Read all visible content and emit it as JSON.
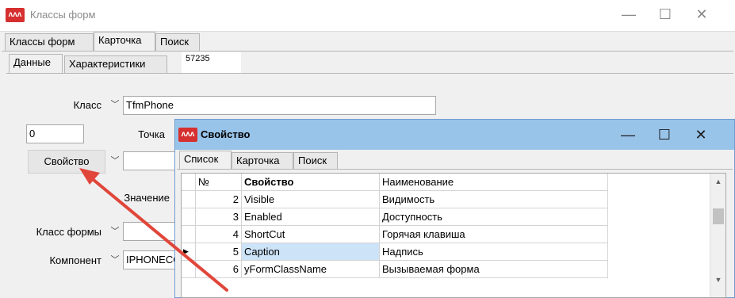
{
  "main_window": {
    "title": "Классы форм",
    "app_icon": "ᴧᴧᴧ",
    "minimize": "—",
    "maximize": "☐",
    "close": "✕"
  },
  "main_tabs": [
    {
      "label": "Классы форм"
    },
    {
      "label": "Карточка"
    },
    {
      "label": "Поиск"
    }
  ],
  "sub_tabs": [
    {
      "label": "Данные"
    },
    {
      "label": "Характеристики"
    }
  ],
  "record_id": "57235",
  "form": {
    "class_label": "Класс",
    "class_value": "TfmPhone",
    "number_value": "0",
    "precision_label": "Точка",
    "property_label": "Свойство",
    "value_label": "Значение",
    "form_class_label": "Класс формы",
    "component_label": "Компонент",
    "component_value": "IPHONECO",
    "chevron": "﹀"
  },
  "dialog": {
    "title": "Свойство",
    "app_icon": "ᴧᴧᴧ",
    "minimize": "—",
    "maximize": "☐",
    "close": "✕",
    "tabs": [
      {
        "label": "Список"
      },
      {
        "label": "Карточка"
      },
      {
        "label": "Поиск"
      }
    ],
    "grid": {
      "headers": {
        "num": "№",
        "property": "Свойство",
        "name": "Наименование"
      },
      "rows": [
        {
          "num": "2",
          "property": "Visible",
          "name": "Видимость"
        },
        {
          "num": "3",
          "property": "Enabled",
          "name": "Доступность"
        },
        {
          "num": "4",
          "property": "ShortCut",
          "name": "Горячая клавиша"
        },
        {
          "num": "5",
          "property": "Caption",
          "name": "Надпись"
        },
        {
          "num": "6",
          "property": "yFormClassName",
          "name": "Вызываемая форма"
        }
      ],
      "current_row_marker": "▶",
      "scroll_up": "▲",
      "scroll_down": "▼"
    }
  },
  "colors": {
    "annotation_arrow": "#e0463a",
    "dialog_titlebar": "#99c4ea",
    "selected_cell": "#cce3f8"
  }
}
